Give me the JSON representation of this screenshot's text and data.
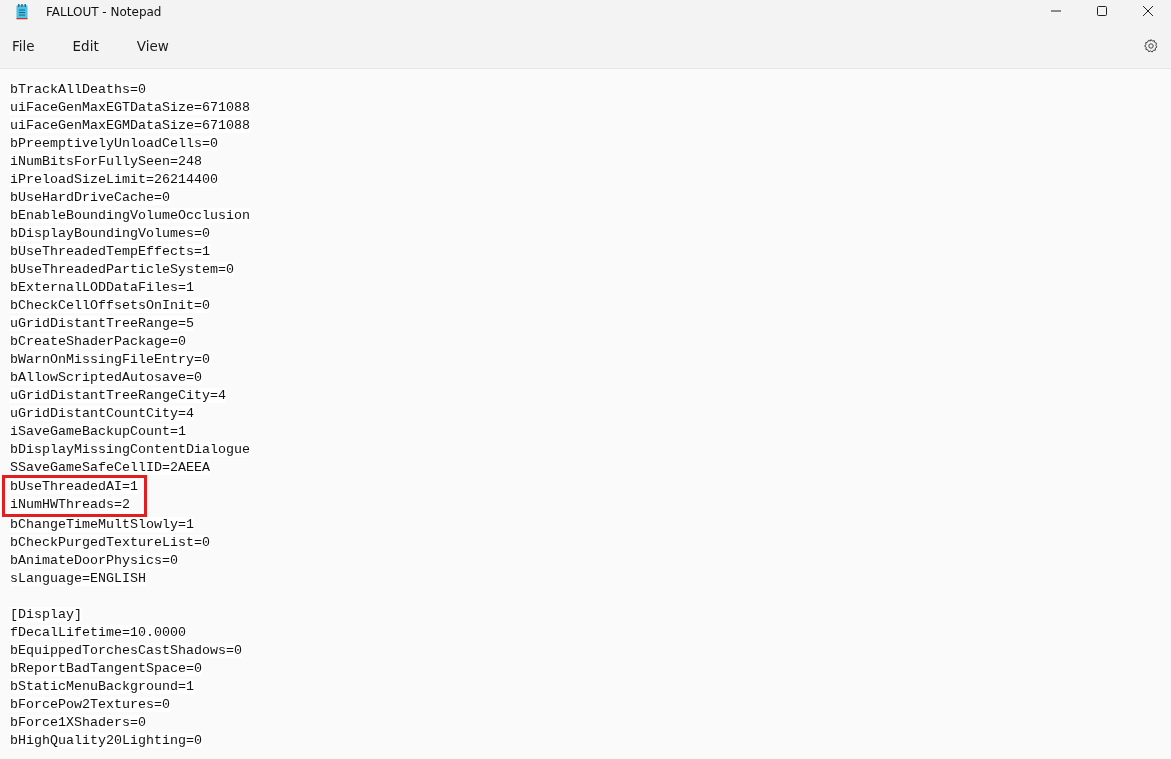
{
  "window": {
    "title": "FALLOUT - Notepad"
  },
  "menu": [
    {
      "label": "File"
    },
    {
      "label": "Edit"
    },
    {
      "label": "View"
    }
  ],
  "lines": [
    {
      "kind": "text",
      "text": "bTrackAllDeaths=0",
      "boxed": false
    },
    {
      "kind": "text",
      "text": "uiFaceGenMaxEGTDataSize=671088",
      "boxed": false
    },
    {
      "kind": "text",
      "text": "uiFaceGenMaxEGMDataSize=671088",
      "boxed": false
    },
    {
      "kind": "text",
      "text": "bPreemptivelyUnloadCells=0",
      "boxed": false
    },
    {
      "kind": "text",
      "text": "iNumBitsForFullySeen=248",
      "boxed": false
    },
    {
      "kind": "text",
      "text": "iPreloadSizeLimit=26214400",
      "boxed": false
    },
    {
      "kind": "text",
      "text": "bUseHardDriveCache=0",
      "boxed": false
    },
    {
      "kind": "text",
      "text": "bEnableBoundingVolumeOcclusion",
      "boxed": false
    },
    {
      "kind": "text",
      "text": "bDisplayBoundingVolumes=0",
      "boxed": false
    },
    {
      "kind": "text",
      "text": "bUseThreadedTempEffects=1",
      "boxed": false
    },
    {
      "kind": "text",
      "text": "bUseThreadedParticleSystem=0",
      "boxed": false
    },
    {
      "kind": "text",
      "text": "bExternalLODDataFiles=1",
      "boxed": false
    },
    {
      "kind": "text",
      "text": "bCheckCellOffsetsOnInit=0",
      "boxed": false
    },
    {
      "kind": "text",
      "text": "uGridDistantTreeRange=5",
      "boxed": false
    },
    {
      "kind": "text",
      "text": "bCreateShaderPackage=0",
      "boxed": false
    },
    {
      "kind": "text",
      "text": "bWarnOnMissingFileEntry=0",
      "boxed": false
    },
    {
      "kind": "text",
      "text": "bAllowScriptedAutosave=0",
      "boxed": false
    },
    {
      "kind": "text",
      "text": "uGridDistantTreeRangeCity=4",
      "boxed": false
    },
    {
      "kind": "text",
      "text": "uGridDistantCountCity=4",
      "boxed": false
    },
    {
      "kind": "text",
      "text": "iSaveGameBackupCount=1",
      "boxed": false
    },
    {
      "kind": "text",
      "text": "bDisplayMissingContentDialogue",
      "boxed": false
    },
    {
      "kind": "text",
      "text": "SSaveGameSafeCellID=2AEEA",
      "boxed": false
    },
    {
      "kind": "text",
      "text": "bUseThreadedAI=1",
      "boxed": true
    },
    {
      "kind": "text",
      "text": "iNumHWThreads=2",
      "boxed": true
    },
    {
      "kind": "text",
      "text": "bChangeTimeMultSlowly=1",
      "boxed": false
    },
    {
      "kind": "text",
      "text": "bCheckPurgedTextureList=0",
      "boxed": false
    },
    {
      "kind": "text",
      "text": "bAnimateDoorPhysics=0",
      "boxed": false
    },
    {
      "kind": "text",
      "text": "sLanguage=ENGLISH",
      "boxed": false
    },
    {
      "kind": "blank"
    },
    {
      "kind": "text",
      "text": "[Display]",
      "boxed": false
    },
    {
      "kind": "text",
      "text": "fDecalLifetime=10.0000",
      "boxed": false
    },
    {
      "kind": "text",
      "text": "bEquippedTorchesCastShadows=0",
      "boxed": false
    },
    {
      "kind": "text",
      "text": "bReportBadTangentSpace=0",
      "boxed": false
    },
    {
      "kind": "text",
      "text": "bStaticMenuBackground=1",
      "boxed": false
    },
    {
      "kind": "text",
      "text": "bForcePow2Textures=0",
      "boxed": false
    },
    {
      "kind": "text",
      "text": "bForce1XShaders=0",
      "boxed": false
    },
    {
      "kind": "text",
      "text": "bHighQuality20Lighting=0",
      "boxed": false
    }
  ]
}
